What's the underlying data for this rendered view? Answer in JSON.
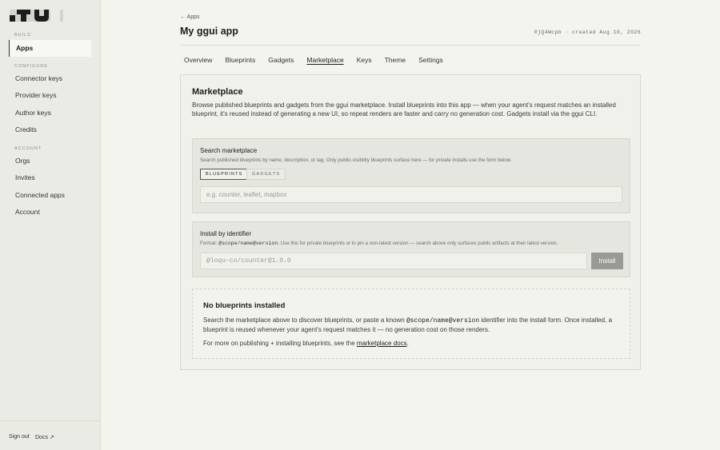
{
  "sidebar": {
    "sections": {
      "build": "Build",
      "configure": "Configure",
      "account": "Account"
    },
    "build_items": [
      {
        "label": "Apps"
      }
    ],
    "configure_items": [
      {
        "label": "Connector keys"
      },
      {
        "label": "Provider keys"
      },
      {
        "label": "Author keys"
      },
      {
        "label": "Credits"
      }
    ],
    "account_items": [
      {
        "label": "Orgs"
      },
      {
        "label": "Invites"
      },
      {
        "label": "Connected apps"
      },
      {
        "label": "Account"
      }
    ],
    "footer": {
      "sign_out": "Sign out",
      "docs": "Docs ↗"
    }
  },
  "header": {
    "back_label": "← Apps",
    "title": "My ggui app",
    "meta": "0jQ4Wcpb · created Aug 10, 2026"
  },
  "tabs": [
    {
      "label": "Overview"
    },
    {
      "label": "Blueprints"
    },
    {
      "label": "Gadgets"
    },
    {
      "label": "Marketplace",
      "active": true
    },
    {
      "label": "Keys"
    },
    {
      "label": "Theme"
    },
    {
      "label": "Settings"
    }
  ],
  "marketplace": {
    "title": "Marketplace",
    "description": "Browse published blueprints and gadgets from the ggui marketplace. Install blueprints into this app — when your agent's request matches an installed blueprint, it's reused instead of generating a new UI, so repeat renders are faster and carry no generation cost. Gadgets install via the ggui CLI.",
    "search": {
      "title": "Search marketplace",
      "description": "Search published blueprints by name, description, or tag. Only public-visibility blueprints surface here — for private installs use the form below.",
      "chips": [
        {
          "label": "Blueprints",
          "active": true
        },
        {
          "label": "Gadgets",
          "active": false
        }
      ],
      "placeholder": "e.g. counter, leaflet, mapbox"
    },
    "install": {
      "title": "Install by identifier",
      "desc_prefix": "Format:",
      "desc_code": "@scope/name@version",
      "desc_suffix": ". Use this for private blueprints or to pin a non-latest version — search above only surfaces public artifacts at their latest version.",
      "placeholder": "@loqu-co/counter@1.0.0",
      "button": "Install"
    },
    "empty": {
      "title": "No blueprints installed",
      "p1_prefix": "Search the marketplace above to discover blueprints, or paste a known",
      "p1_code": "@scope/name@version",
      "p1_suffix": "identifier into the install form. Once installed, a blueprint is reused whenever your agent's request matches it — no generation cost on those renders.",
      "p2_prefix": "For more on publishing + installing blueprints, see the",
      "p2_link": "marketplace docs",
      "p2_suffix": "."
    }
  },
  "colors": {
    "background": "#f4f4ef",
    "sidebar": "#ebebe6",
    "button": "#9a9a95"
  }
}
